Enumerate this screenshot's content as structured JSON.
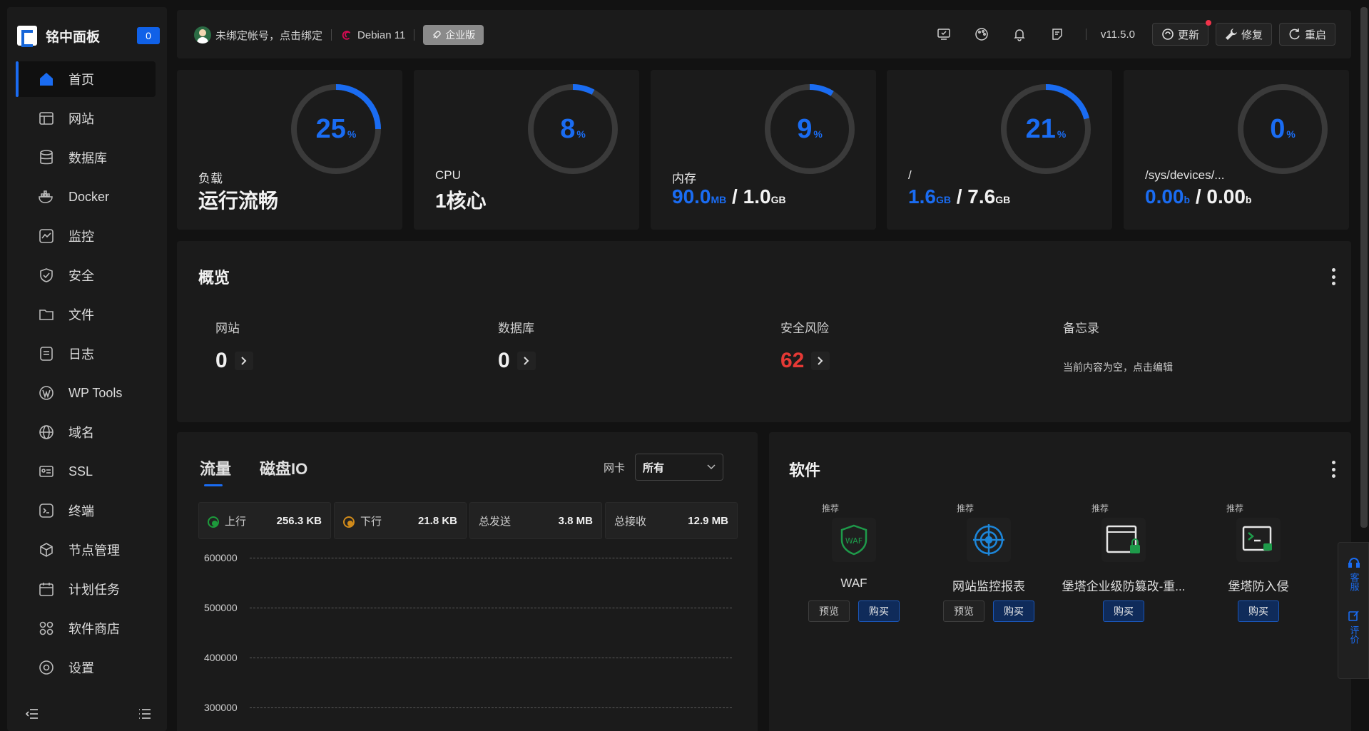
{
  "brand": {
    "title": "铭中面板",
    "badge": "0"
  },
  "sidebar": {
    "items": [
      {
        "label": "首页",
        "icon": "home-icon",
        "active": true
      },
      {
        "label": "网站",
        "icon": "website-icon"
      },
      {
        "label": "数据库",
        "icon": "database-icon"
      },
      {
        "label": "Docker",
        "icon": "docker-icon"
      },
      {
        "label": "监控",
        "icon": "monitor-icon"
      },
      {
        "label": "安全",
        "icon": "shield-icon"
      },
      {
        "label": "文件",
        "icon": "folder-icon"
      },
      {
        "label": "日志",
        "icon": "log-icon"
      },
      {
        "label": "WP Tools",
        "icon": "wordpress-icon"
      },
      {
        "label": "域名",
        "icon": "globe-icon"
      },
      {
        "label": "SSL",
        "icon": "ssl-icon"
      },
      {
        "label": "终端",
        "icon": "terminal-icon"
      },
      {
        "label": "节点管理",
        "icon": "cube-icon"
      },
      {
        "label": "计划任务",
        "icon": "calendar-icon"
      },
      {
        "label": "软件商店",
        "icon": "apps-icon"
      },
      {
        "label": "设置",
        "icon": "settings-icon"
      }
    ]
  },
  "topbar": {
    "account": "未绑定帐号，点击绑定",
    "os": "Debian 11",
    "edition": "企业版",
    "version": "v11.5.0",
    "update_label": "更新",
    "repair_label": "修复",
    "restart_label": "重启"
  },
  "stats": [
    {
      "percent": "25",
      "unit": "%",
      "label": "负载",
      "main": "运行流畅"
    },
    {
      "percent": "8",
      "unit": "%",
      "label": "CPU",
      "main": "1核心"
    },
    {
      "percent": "9",
      "unit": "%",
      "label": "内存",
      "used": "90.0",
      "used_unit": "MB",
      "sep": " / ",
      "total": "1.0",
      "total_unit": "GB"
    },
    {
      "percent": "21",
      "unit": "%",
      "label": "/",
      "used": "1.6",
      "used_unit": "GB",
      "sep": " / ",
      "total": "7.6",
      "total_unit": "GB"
    },
    {
      "percent": "0",
      "unit": "%",
      "label": "/sys/devices/...",
      "used": "0.00",
      "used_unit": "b",
      "sep": " / ",
      "total": "0.00",
      "total_unit": "b"
    }
  ],
  "overview": {
    "title": "概览",
    "items": [
      {
        "label": "网站",
        "value": "0"
      },
      {
        "label": "数据库",
        "value": "0"
      },
      {
        "label": "安全风险",
        "value": "62"
      }
    ],
    "memo": {
      "label": "备忘录",
      "text": "当前内容为空，点击编辑"
    }
  },
  "traffic": {
    "tabs": [
      "流量",
      "磁盘IO"
    ],
    "nic_label": "网卡",
    "nic_value": "所有",
    "metrics": [
      {
        "label": "上行",
        "value": "256.3 KB"
      },
      {
        "label": "下行",
        "value": "21.8 KB"
      },
      {
        "label": "总发送",
        "value": "3.8 MB"
      },
      {
        "label": "总接收",
        "value": "12.9 MB"
      }
    ],
    "y_ticks": [
      "600000",
      "500000",
      "400000",
      "300000"
    ]
  },
  "software": {
    "title": "软件",
    "items": [
      {
        "tag": "推荐",
        "name": "WAF",
        "preview": "预览",
        "buy": "购买"
      },
      {
        "tag": "推荐",
        "name": "网站监控报表",
        "preview": "预览",
        "buy": "购买"
      },
      {
        "tag": "推荐",
        "name": "堡塔企业级防篡改-重...",
        "buy": "购买"
      },
      {
        "tag": "推荐",
        "name": "堡塔防入侵",
        "buy": "购买"
      }
    ]
  },
  "float": {
    "service": "客服",
    "review": "评价"
  },
  "colors": {
    "accent": "#1a6cf2",
    "danger": "#e53935",
    "panel": "#1b1b1b",
    "bg": "#121212"
  }
}
